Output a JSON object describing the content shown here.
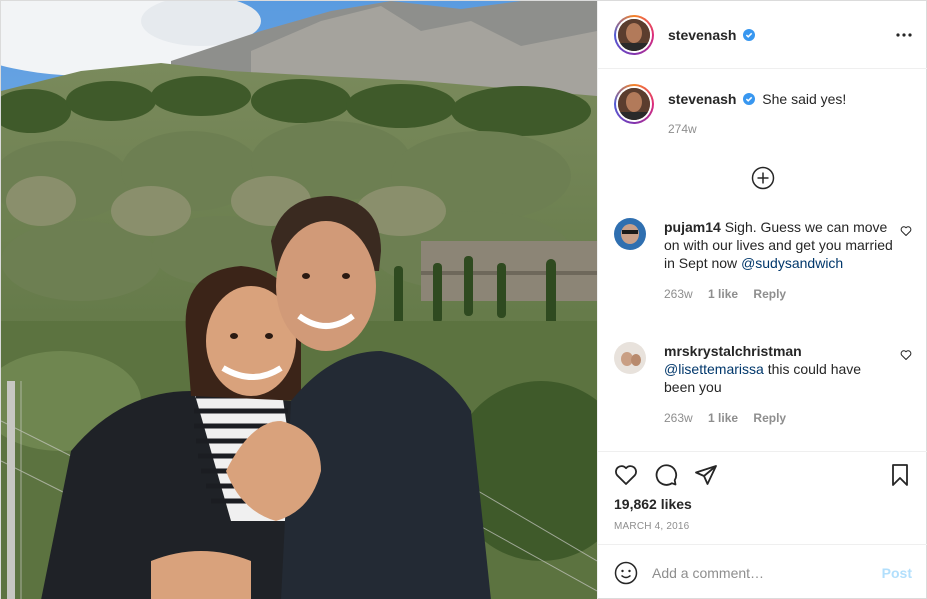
{
  "post": {
    "photo_alt": "Couple posing in front of mountains and olive trees",
    "author": {
      "username": "stevenash",
      "verified_icon": "verified-badge-icon"
    },
    "caption": {
      "username": "stevenash",
      "text": "She said yes!",
      "time": "274w"
    },
    "load_more_icon": "plus-circle-icon",
    "comments": [
      {
        "username": "pujam14",
        "text": "Sigh. Guess we can move on with our lives and get you married in Sept now",
        "mention": "@sudysandwich",
        "time": "263w",
        "likes": "1 like",
        "reply": "Reply"
      },
      {
        "username": "mrskrystalchristman",
        "mention": "@lisettemarissa",
        "text": "this could have been you",
        "time": "263w",
        "likes": "1 like",
        "reply": "Reply"
      }
    ],
    "likes": "19,862 likes",
    "date": "March 4, 2016",
    "add_comment": {
      "placeholder": "Add a comment…",
      "post_label": "Post"
    }
  },
  "colors": {
    "verified": "#3897f0",
    "mention": "#00376b",
    "muted": "#8e8e8e",
    "post_disabled": "#b2dffc"
  }
}
